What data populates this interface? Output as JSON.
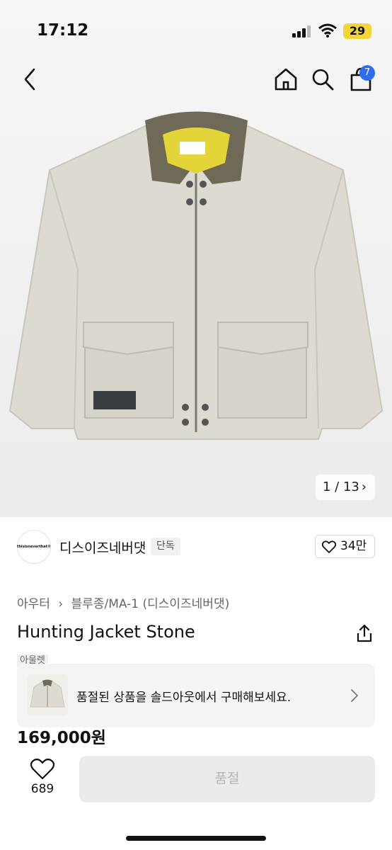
{
  "status": {
    "time": "17:12",
    "battery": "29"
  },
  "header": {
    "cart_badge": "7",
    "icons": {
      "back": "chevron-left-icon",
      "home": "home-icon",
      "search": "search-icon",
      "cart": "shopping-bag-icon"
    }
  },
  "gallery": {
    "counter": "1 / 13",
    "next_symbol": "›"
  },
  "brand": {
    "logo_text": "thisisneverthat®",
    "name": "디스이즈네버댓",
    "tag": "단독",
    "likes": "34만"
  },
  "product": {
    "breadcrumb": [
      "아우터",
      "블루종/MA-1 (디스이즈네버댓)"
    ],
    "breadcrumb_sep": "›",
    "title": "Hunting Jacket Stone",
    "partial_tag": "아울렛",
    "price": "169,000원"
  },
  "soldout_banner": {
    "text": "품절된 상품을 솔드아웃에서 구매해보세요."
  },
  "bottom_bar": {
    "wish_count": "689",
    "buy_label": "품절"
  },
  "colors": {
    "badge": "#2f6cf0",
    "battery": "#f3d53a",
    "jacket": "#dcdad1",
    "collar": "#6f6a57",
    "lining": "#e3d43a"
  }
}
